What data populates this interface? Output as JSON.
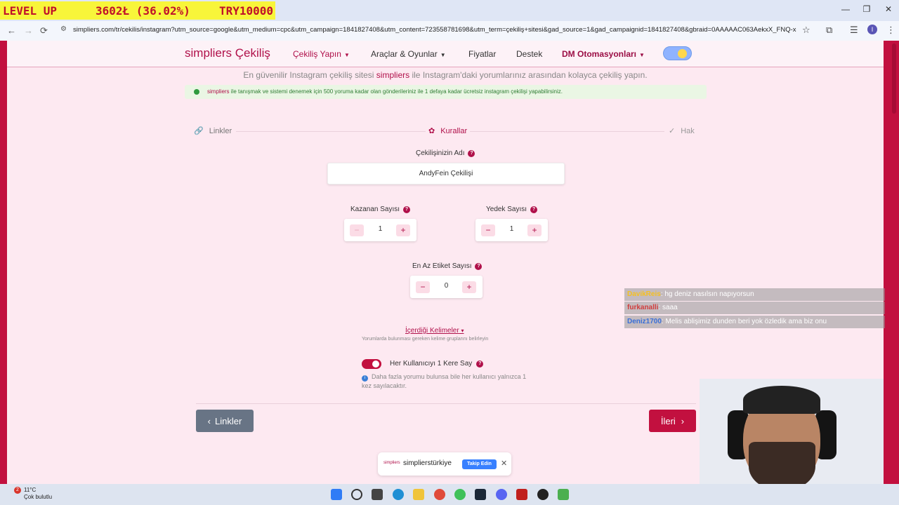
{
  "overlay": {
    "title": "LEVEL UP",
    "points": "3602Ł (36.02%)",
    "currency": "TRY10000"
  },
  "window": {
    "min": "—",
    "max": "❐",
    "close": "✕"
  },
  "browser": {
    "url": "simpliers.com/tr/cekilis/instagram?utm_source=google&utm_medium=cpc&utm_campaign=1841827408&utm_content=723558781698&utm_term=çekiliş+sitesi&gad_source=1&gad_campaignid=1841827408&gbraid=0AAAAAC063AekxX_FNQ-xg2...",
    "back": "←",
    "forward": "→",
    "reload": "⟳",
    "profile_initial": "I"
  },
  "nav": {
    "brand": "simpliers Çekiliş",
    "items": [
      "Çekiliş Yapın",
      "Araçlar & Oyunlar",
      "Fiyatlar",
      "Destek",
      "DM Otomasyonları"
    ]
  },
  "hero": {
    "pre": "En güvenilir Instagram çekiliş sitesi ",
    "brand": "simpliers",
    "post": " ile Instagram'daki yorumlarınız arasından kolayca çekiliş yapın."
  },
  "info": {
    "brand": "simpliers",
    "text": " ile tanışmak ve sistemi denemek için 500 yoruma kadar olan gönderileriniz ile 1 defaya kadar ücretsiz instagram çekilişi yapabilirsiniz."
  },
  "steps": [
    {
      "label": "Linkler"
    },
    {
      "label": "Kurallar"
    },
    {
      "label": "Hak"
    }
  ],
  "form": {
    "name_label": "Çekilişinizin Adı",
    "name_value": "AndyFein Çekilişi",
    "winners_label": "Kazanan Sayısı",
    "winners_value": "1",
    "backup_label": "Yedek Sayısı",
    "backup_value": "1",
    "tag_label": "En Az Etiket Sayısı",
    "tag_value": "0",
    "keywords_label": "İçerdiği Kelimeler",
    "keywords_hint": "Yorumlarda bulunması gereken kelime gruplarını belirleyin",
    "count_once_label": "Her Kullanıcıyı 1 Kere Say",
    "count_once_note": "Daha fazla yorumu bulunsa bile her kullanıcı yalnızca 1 kez sayılacaktır.",
    "count_once_enabled": true
  },
  "buttons": {
    "back": "Linkler",
    "next": "İleri"
  },
  "follow": {
    "logo": "simpliers",
    "account": "simplierstürkiye",
    "follow_label": "Takip Edin"
  },
  "chat": [
    {
      "user": "DavikReis",
      "msg": ": hg deniz nasılsın napıyorsun"
    },
    {
      "user": "furkanalli",
      "msg": ": saaa"
    },
    {
      "user": "Deniz1700",
      "msg": ": Melis ablişimiz dunden beri yok özledik ama biz onu"
    }
  ],
  "taskbar": {
    "temp": "11°C",
    "condition": "Çok bulutlu",
    "badge": "2"
  },
  "colors": {
    "brand": "#c2103f",
    "brand_dark": "#b0104a",
    "success": "#3da34a"
  }
}
